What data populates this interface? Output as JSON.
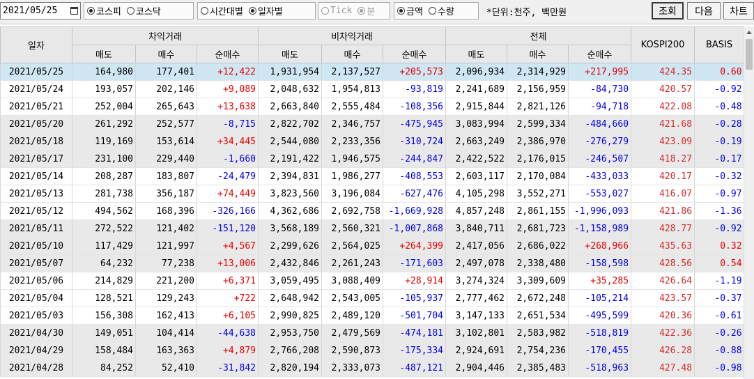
{
  "toolbar": {
    "date": "2021/05/25",
    "market_options": [
      {
        "label": "코스피",
        "selected": true
      },
      {
        "label": "코스닥",
        "selected": false
      }
    ],
    "period_options": [
      {
        "label": "시간대별",
        "selected": false
      },
      {
        "label": "일자별",
        "selected": true
      }
    ],
    "interval_options": [
      {
        "label": "Tick",
        "selected": false
      },
      {
        "label": "분",
        "selected": true
      }
    ],
    "value_options": [
      {
        "label": "금액",
        "selected": true
      },
      {
        "label": "수량",
        "selected": false
      }
    ],
    "unit_text": "*단위:천주, 백만원",
    "query_button": "조회",
    "next_button": "다음",
    "chart_button": "차트"
  },
  "table": {
    "group_headers": {
      "date": "일자",
      "arbitrage": "차익거래",
      "non_arbitrage": "비차익거래",
      "total": "전체",
      "kospi200": "KOSPI200",
      "basis": "BASIS"
    },
    "sub_headers": {
      "sell": "매도",
      "buy": "매수",
      "net": "순매수"
    },
    "rows": [
      {
        "date": "2021/05/25",
        "a_sell": "164,980",
        "a_buy": "177,401",
        "a_net": "+12,422",
        "n_sell": "1,931,954",
        "n_buy": "2,137,527",
        "n_net": "+205,573",
        "t_sell": "2,096,934",
        "t_buy": "2,314,929",
        "t_net": "+217,995",
        "kospi": "424.35",
        "basis": "0.60"
      },
      {
        "date": "2021/05/24",
        "a_sell": "193,057",
        "a_buy": "202,146",
        "a_net": "+9,089",
        "n_sell": "2,048,632",
        "n_buy": "1,954,813",
        "n_net": "-93,819",
        "t_sell": "2,241,689",
        "t_buy": "2,156,959",
        "t_net": "-84,730",
        "kospi": "420.57",
        "basis": "-0.92"
      },
      {
        "date": "2021/05/21",
        "a_sell": "252,004",
        "a_buy": "265,643",
        "a_net": "+13,638",
        "n_sell": "2,663,840",
        "n_buy": "2,555,484",
        "n_net": "-108,356",
        "t_sell": "2,915,844",
        "t_buy": "2,821,126",
        "t_net": "-94,718",
        "kospi": "422.08",
        "basis": "-0.48"
      },
      {
        "date": "2021/05/20",
        "a_sell": "261,292",
        "a_buy": "252,577",
        "a_net": "-8,715",
        "n_sell": "2,822,702",
        "n_buy": "2,346,757",
        "n_net": "-475,945",
        "t_sell": "3,083,994",
        "t_buy": "2,599,334",
        "t_net": "-484,660",
        "kospi": "421.68",
        "basis": "-0.28"
      },
      {
        "date": "2021/05/18",
        "a_sell": "119,169",
        "a_buy": "153,614",
        "a_net": "+34,445",
        "n_sell": "2,544,080",
        "n_buy": "2,233,356",
        "n_net": "-310,724",
        "t_sell": "2,663,249",
        "t_buy": "2,386,970",
        "t_net": "-276,279",
        "kospi": "423.09",
        "basis": "-0.19"
      },
      {
        "date": "2021/05/17",
        "a_sell": "231,100",
        "a_buy": "229,440",
        "a_net": "-1,660",
        "n_sell": "2,191,422",
        "n_buy": "1,946,575",
        "n_net": "-244,847",
        "t_sell": "2,422,522",
        "t_buy": "2,176,015",
        "t_net": "-246,507",
        "kospi": "418.27",
        "basis": "-0.17"
      },
      {
        "date": "2021/05/14",
        "a_sell": "208,287",
        "a_buy": "183,807",
        "a_net": "-24,479",
        "n_sell": "2,394,831",
        "n_buy": "1,986,277",
        "n_net": "-408,553",
        "t_sell": "2,603,117",
        "t_buy": "2,170,084",
        "t_net": "-433,033",
        "kospi": "420.17",
        "basis": "-0.32"
      },
      {
        "date": "2021/05/13",
        "a_sell": "281,738",
        "a_buy": "356,187",
        "a_net": "+74,449",
        "n_sell": "3,823,560",
        "n_buy": "3,196,084",
        "n_net": "-627,476",
        "t_sell": "4,105,298",
        "t_buy": "3,552,271",
        "t_net": "-553,027",
        "kospi": "416.07",
        "basis": "-0.97"
      },
      {
        "date": "2021/05/12",
        "a_sell": "494,562",
        "a_buy": "168,396",
        "a_net": "-326,166",
        "n_sell": "4,362,686",
        "n_buy": "2,692,758",
        "n_net": "-1,669,928",
        "t_sell": "4,857,248",
        "t_buy": "2,861,155",
        "t_net": "-1,996,093",
        "kospi": "421.86",
        "basis": "-1.36"
      },
      {
        "date": "2021/05/11",
        "a_sell": "272,522",
        "a_buy": "121,402",
        "a_net": "-151,120",
        "n_sell": "3,568,189",
        "n_buy": "2,560,321",
        "n_net": "-1,007,868",
        "t_sell": "3,840,711",
        "t_buy": "2,681,723",
        "t_net": "-1,158,989",
        "kospi": "428.77",
        "basis": "-0.92"
      },
      {
        "date": "2021/05/10",
        "a_sell": "117,429",
        "a_buy": "121,997",
        "a_net": "+4,567",
        "n_sell": "2,299,626",
        "n_buy": "2,564,025",
        "n_net": "+264,399",
        "t_sell": "2,417,056",
        "t_buy": "2,686,022",
        "t_net": "+268,966",
        "kospi": "435.63",
        "basis": "0.32"
      },
      {
        "date": "2021/05/07",
        "a_sell": "64,232",
        "a_buy": "77,238",
        "a_net": "+13,006",
        "n_sell": "2,432,846",
        "n_buy": "2,261,243",
        "n_net": "-171,603",
        "t_sell": "2,497,078",
        "t_buy": "2,338,480",
        "t_net": "-158,598",
        "kospi": "428.56",
        "basis": "0.54"
      },
      {
        "date": "2021/05/06",
        "a_sell": "214,829",
        "a_buy": "221,200",
        "a_net": "+6,371",
        "n_sell": "3,059,495",
        "n_buy": "3,088,409",
        "n_net": "+28,914",
        "t_sell": "3,274,324",
        "t_buy": "3,309,609",
        "t_net": "+35,285",
        "kospi": "426.64",
        "basis": "-1.19"
      },
      {
        "date": "2021/05/04",
        "a_sell": "128,521",
        "a_buy": "129,243",
        "a_net": "+722",
        "n_sell": "2,648,942",
        "n_buy": "2,543,005",
        "n_net": "-105,937",
        "t_sell": "2,777,462",
        "t_buy": "2,672,248",
        "t_net": "-105,214",
        "kospi": "423.57",
        "basis": "-0.37"
      },
      {
        "date": "2021/05/03",
        "a_sell": "156,308",
        "a_buy": "162,413",
        "a_net": "+6,105",
        "n_sell": "2,990,825",
        "n_buy": "2,489,120",
        "n_net": "-501,704",
        "t_sell": "3,147,133",
        "t_buy": "2,651,534",
        "t_net": "-495,599",
        "kospi": "420.36",
        "basis": "-0.61"
      },
      {
        "date": "2021/04/30",
        "a_sell": "149,051",
        "a_buy": "104,414",
        "a_net": "-44,638",
        "n_sell": "2,953,750",
        "n_buy": "2,479,569",
        "n_net": "-474,181",
        "t_sell": "3,102,801",
        "t_buy": "2,583,982",
        "t_net": "-518,819",
        "kospi": "422.36",
        "basis": "-0.26"
      },
      {
        "date": "2021/04/29",
        "a_sell": "158,484",
        "a_buy": "163,363",
        "a_net": "+4,879",
        "n_sell": "2,766,208",
        "n_buy": "2,590,873",
        "n_net": "-175,334",
        "t_sell": "2,924,691",
        "t_buy": "2,754,236",
        "t_net": "-170,455",
        "kospi": "426.28",
        "basis": "-0.88"
      },
      {
        "date": "2021/04/28",
        "a_sell": "84,252",
        "a_buy": "52,410",
        "a_net": "-31,842",
        "n_sell": "2,820,194",
        "n_buy": "2,333,073",
        "n_net": "-487,121",
        "t_sell": "2,904,446",
        "t_buy": "2,385,483",
        "t_net": "-518,963",
        "kospi": "427.48",
        "basis": "-0.98"
      }
    ]
  },
  "colors": {
    "positive": "#e60000",
    "negative": "#0000e6",
    "index": "#d42a2a",
    "selected_row": "#cfe6f3",
    "gray_row": "#e9e9e9"
  }
}
